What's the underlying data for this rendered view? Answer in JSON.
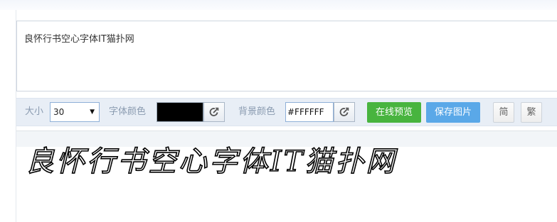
{
  "editor": {
    "text": "良怀行书空心字体IT猫扑网"
  },
  "toolbar": {
    "size_label": "大小",
    "size_value": "30",
    "font_color_label": "字体颜色",
    "font_color": "#000000",
    "bg_color_label": "背景颜色",
    "bg_color_value": "#FFFFFF",
    "preview_button": "在线预览",
    "save_button": "保存图片",
    "simplified_button": "简",
    "traditional_button": "繁"
  },
  "preview": {
    "text": "良怀行书空心字体IT猫扑网",
    "font_color": "#000000",
    "bg_color": "#FFFFFF"
  },
  "colors": {
    "accent_green": "#48b43f",
    "accent_blue": "#5aa8e8"
  },
  "icons": {
    "picker": "color-picker-icon"
  }
}
